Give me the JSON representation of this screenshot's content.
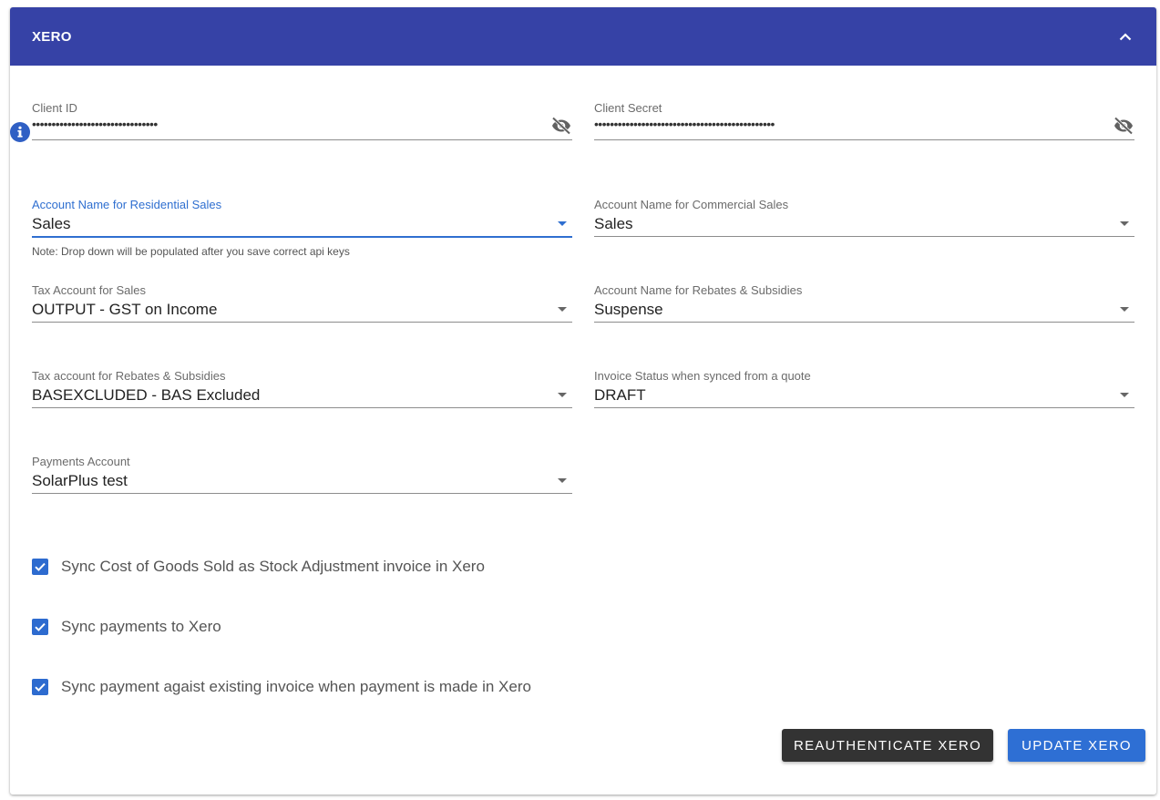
{
  "header": {
    "title": "XERO"
  },
  "fields": {
    "client_id": {
      "label": "Client ID",
      "value": "••••••••••••••••••••••••••••••••"
    },
    "client_secret": {
      "label": "Client Secret",
      "value": "••••••••••••••••••••••••••••••••••••••••••••••"
    },
    "residential_sales": {
      "label": "Account Name for Residential Sales",
      "value": "Sales",
      "note": "Note: Drop down will be populated after you save correct api keys"
    },
    "commercial_sales": {
      "label": "Account Name for Commercial Sales",
      "value": "Sales"
    },
    "tax_sales": {
      "label": "Tax Account for Sales",
      "value": "OUTPUT - GST on Income"
    },
    "rebates_account": {
      "label": "Account Name for Rebates & Subsidies",
      "value": "Suspense"
    },
    "tax_rebates": {
      "label": "Tax account for Rebates & Subsidies",
      "value": "BASEXCLUDED - BAS Excluded"
    },
    "invoice_status": {
      "label": "Invoice Status when synced from a quote",
      "value": "DRAFT"
    },
    "payments_account": {
      "label": "Payments Account",
      "value": "SolarPlus test"
    }
  },
  "checkboxes": [
    {
      "label": "Sync Cost of Goods Sold as Stock Adjustment invoice in Xero",
      "checked": true
    },
    {
      "label": "Sync payments to Xero",
      "checked": true
    },
    {
      "label": "Sync payment agaist existing invoice when payment is made in Xero",
      "checked": true
    }
  ],
  "buttons": {
    "reauthenticate": "REAUTHENTICATE XERO",
    "update": "UPDATE XERO"
  },
  "colors": {
    "header": "#3642a6",
    "accent": "#2e6fd4",
    "dark_button": "#333333"
  },
  "icons": {
    "collapse": "chevron-up-icon",
    "info": "info-icon",
    "visibility": "eye-off-icon",
    "dropdown": "caret-down-icon",
    "check": "check-icon"
  }
}
